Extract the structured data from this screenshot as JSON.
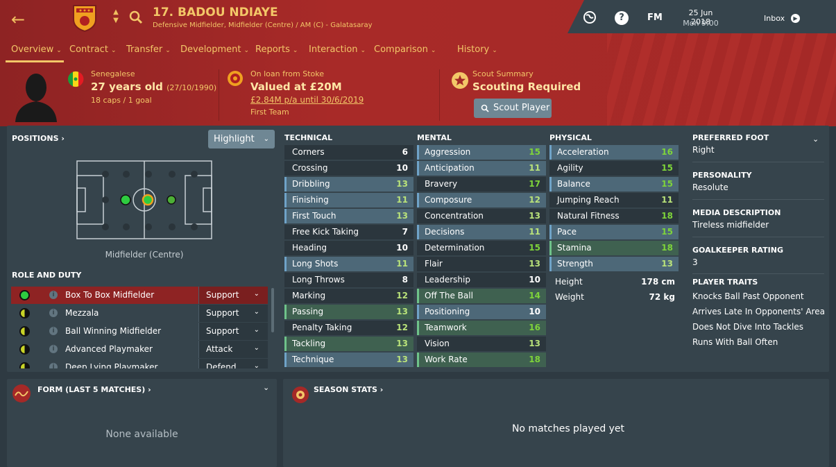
{
  "header": {
    "player_name": "17. BADOU NDIAYE",
    "subtitle": "Defensive Midfielder, Midfielder (Centre) / AM (C) - Galatasaray",
    "date": "25 Jun 2018",
    "time": "Mon 9:00",
    "fm_label": "FM",
    "inbox_label": "Inbox",
    "help_label": "?",
    "accent_color": "#f3c768"
  },
  "tabs": [
    {
      "label": "Overview"
    },
    {
      "label": "Contract"
    },
    {
      "label": "Transfer"
    },
    {
      "label": "Development"
    },
    {
      "label": "Reports"
    },
    {
      "label": "Interaction"
    },
    {
      "label": "Comparison"
    },
    {
      "label": "History"
    }
  ],
  "info": {
    "nationality": "Senegalese",
    "age": "27 years old",
    "dob": "(27/10/1990)",
    "caps": "18 caps / 1 goal",
    "loan": "On loan from Stoke",
    "value": "Valued at £20M",
    "wage": "£2.84M p/a until 30/6/2019",
    "squad": "First Team",
    "scout_title": "Scout Summary",
    "scout_status": "Scouting Required",
    "scout_button": "Scout Player"
  },
  "positions": {
    "title": "POSITIONS",
    "highlight": "Highlight",
    "position_label": "Midfielder (Centre)"
  },
  "roles": {
    "title": "ROLE AND DUTY",
    "items": [
      {
        "name": "Box To Box Midfielder",
        "duty": "Support",
        "rating": "natural"
      },
      {
        "name": "Mezzala",
        "duty": "Support",
        "rating": "good"
      },
      {
        "name": "Ball Winning Midfielder",
        "duty": "Support",
        "rating": "good"
      },
      {
        "name": "Advanced Playmaker",
        "duty": "Attack",
        "rating": "good"
      },
      {
        "name": "Deep Lying Playmaker",
        "duty": "Defend",
        "rating": "good"
      }
    ]
  },
  "technical": {
    "title": "TECHNICAL",
    "items": [
      {
        "name": "Corners",
        "value": "6",
        "hl": ""
      },
      {
        "name": "Crossing",
        "value": "10",
        "hl": ""
      },
      {
        "name": "Dribbling",
        "value": "13",
        "hl": "blue"
      },
      {
        "name": "Finishing",
        "value": "11",
        "hl": "blue"
      },
      {
        "name": "First Touch",
        "value": "13",
        "hl": "blue"
      },
      {
        "name": "Free Kick Taking",
        "value": "7",
        "hl": ""
      },
      {
        "name": "Heading",
        "value": "10",
        "hl": ""
      },
      {
        "name": "Long Shots",
        "value": "11",
        "hl": "blue"
      },
      {
        "name": "Long Throws",
        "value": "8",
        "hl": ""
      },
      {
        "name": "Marking",
        "value": "12",
        "hl": ""
      },
      {
        "name": "Passing",
        "value": "13",
        "hl": "green"
      },
      {
        "name": "Penalty Taking",
        "value": "12",
        "hl": ""
      },
      {
        "name": "Tackling",
        "value": "13",
        "hl": "green"
      },
      {
        "name": "Technique",
        "value": "13",
        "hl": "blue"
      }
    ]
  },
  "mental": {
    "title": "MENTAL",
    "items": [
      {
        "name": "Aggression",
        "value": "15",
        "hl": "blue"
      },
      {
        "name": "Anticipation",
        "value": "11",
        "hl": "blue"
      },
      {
        "name": "Bravery",
        "value": "17",
        "hl": ""
      },
      {
        "name": "Composure",
        "value": "12",
        "hl": "blue"
      },
      {
        "name": "Concentration",
        "value": "13",
        "hl": ""
      },
      {
        "name": "Decisions",
        "value": "11",
        "hl": "blue"
      },
      {
        "name": "Determination",
        "value": "15",
        "hl": ""
      },
      {
        "name": "Flair",
        "value": "13",
        "hl": ""
      },
      {
        "name": "Leadership",
        "value": "10",
        "hl": ""
      },
      {
        "name": "Off The Ball",
        "value": "14",
        "hl": "green"
      },
      {
        "name": "Positioning",
        "value": "10",
        "hl": "blue"
      },
      {
        "name": "Teamwork",
        "value": "16",
        "hl": "green"
      },
      {
        "name": "Vision",
        "value": "13",
        "hl": ""
      },
      {
        "name": "Work Rate",
        "value": "18",
        "hl": "green"
      }
    ]
  },
  "physical": {
    "title": "PHYSICAL",
    "items": [
      {
        "name": "Acceleration",
        "value": "16",
        "hl": "blue"
      },
      {
        "name": "Agility",
        "value": "15",
        "hl": ""
      },
      {
        "name": "Balance",
        "value": "15",
        "hl": "blue"
      },
      {
        "name": "Jumping Reach",
        "value": "11",
        "hl": ""
      },
      {
        "name": "Natural Fitness",
        "value": "18",
        "hl": ""
      },
      {
        "name": "Pace",
        "value": "15",
        "hl": "blue"
      },
      {
        "name": "Stamina",
        "value": "18",
        "hl": "green"
      },
      {
        "name": "Strength",
        "value": "13",
        "hl": "blue"
      }
    ],
    "height_label": "Height",
    "height": "178 cm",
    "weight_label": "Weight",
    "weight": "72 kg"
  },
  "side": {
    "foot_title": "PREFERRED FOOT",
    "foot": "Right",
    "personality_title": "PERSONALITY",
    "personality": "Resolute",
    "media_title": "MEDIA DESCRIPTION",
    "media": "Tireless midfielder",
    "gk_title": "GOALKEEPER RATING",
    "gk": "3",
    "traits_title": "PLAYER TRAITS",
    "traits": [
      "Knocks Ball Past Opponent",
      "Arrives Late In Opponents' Area",
      "Does Not Dive Into Tackles",
      "Runs With Ball Often"
    ]
  },
  "form": {
    "title": "FORM (LAST 5 MATCHES)",
    "empty": "None available"
  },
  "season": {
    "title": "SEASON STATS",
    "empty": "No matches played yet"
  }
}
